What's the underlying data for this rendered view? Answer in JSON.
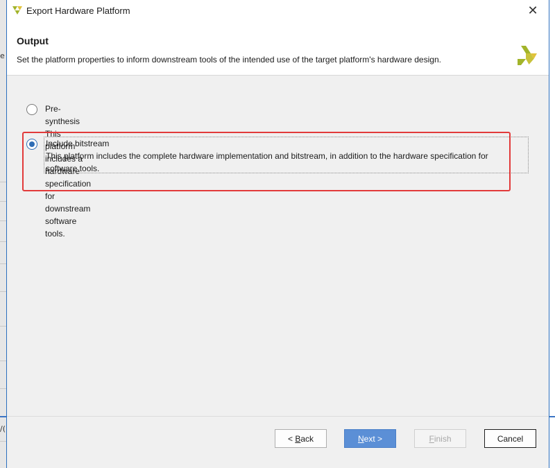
{
  "window": {
    "title": "Export Hardware Platform",
    "close_glyph": "✕"
  },
  "header": {
    "title": "Output",
    "description": "Set the platform properties to inform downstream tools of the intended use of the target platform's hardware design."
  },
  "options": [
    {
      "label": "Pre-synthesis",
      "description": "This platform includes a hardware specification for downstream software tools.",
      "selected": false
    },
    {
      "label": "Include bitstream",
      "description_line1": "This platform includes the complete hardware implementation and bitstream, in addition to the hardware specification for",
      "description_line2": "software tools.",
      "selected": true
    }
  ],
  "buttons": {
    "back": {
      "prefix": "< ",
      "mnemonic": "B",
      "rest": "ack"
    },
    "next": {
      "mnemonic": "N",
      "rest": "ext >"
    },
    "finish": {
      "mnemonic": "F",
      "rest": "inish"
    },
    "cancel": "Cancel"
  },
  "background": {
    "fragment_top": "e",
    "fragment_bottom": "/("
  },
  "colors": {
    "accent": "#5b8fd6",
    "highlight": "#e23a3a",
    "logo_green": "#a2b42a",
    "logo_yellow": "#e0c23b"
  }
}
